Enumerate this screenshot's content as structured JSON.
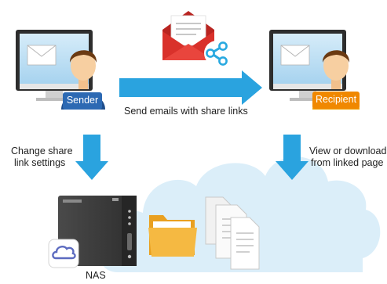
{
  "sender_badge": "Sender",
  "recipient_badge": "Recipient",
  "send_label": "Send emails with share links",
  "change_label_line1": "Change share",
  "change_label_line2": "link settings",
  "view_label_line1": "View or download",
  "view_label_line2": "from linked page",
  "nas_label": "NAS",
  "colors": {
    "arrow": "#2aa3df",
    "cloud": "#dbeef9",
    "badge_sender": "#2c69b3",
    "badge_recipient": "#f08800",
    "envelope_red": "#d9312b",
    "share_icon": "#29a9e0",
    "nas_body": "#3b3b3b",
    "folder": "#f5b942"
  }
}
